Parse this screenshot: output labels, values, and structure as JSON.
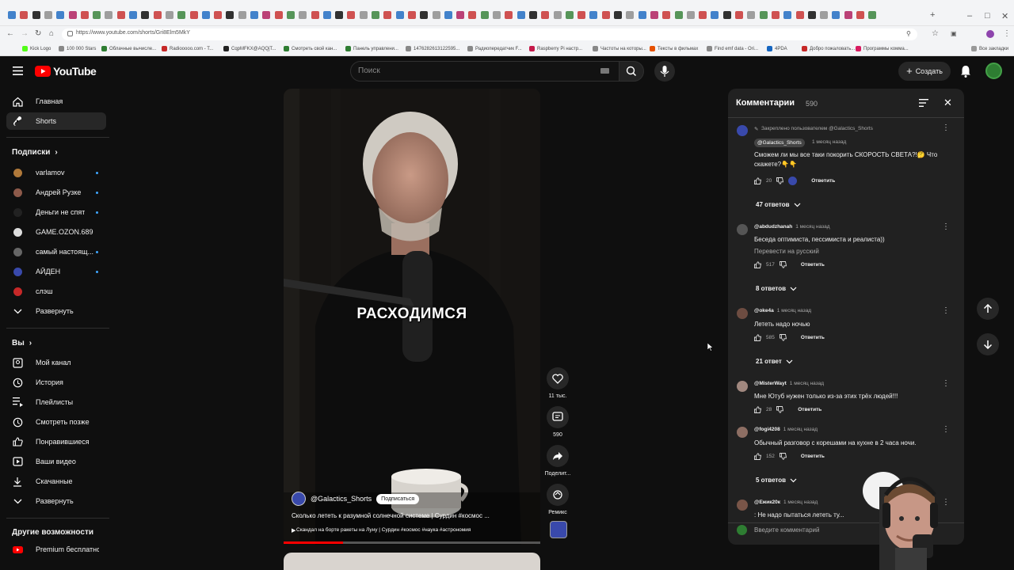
{
  "browser": {
    "url": "https://www.youtube.com/shorts/Gri8Elm5MkY",
    "bookmarks": [
      {
        "label": "Kick Logo",
        "color": "#53fc18"
      },
      {
        "label": "100 000 Stars",
        "color": "#888888"
      },
      {
        "label": "Облачные вычисле...",
        "color": "#2e7d32"
      },
      {
        "label": "Radiooooo.com - T...",
        "color": "#c62828"
      },
      {
        "label": "CqpMFKX@AQQjT...",
        "color": "#222222"
      },
      {
        "label": "Смотреть свой кан...",
        "color": "#2e7d32"
      },
      {
        "label": "Панель управлени...",
        "color": "#2e7d32"
      },
      {
        "label": "1476282613122595...",
        "color": "#888888"
      },
      {
        "label": "Радиопередатчик F...",
        "color": "#888888"
      },
      {
        "label": "Raspberry Pi настр...",
        "color": "#c51a4a"
      },
      {
        "label": "Частоты на которы...",
        "color": "#888888"
      },
      {
        "label": "Тексты в фильмах",
        "color": "#e65100"
      },
      {
        "label": "Find emf data - Ori...",
        "color": "#888888"
      },
      {
        "label": "4PDA",
        "color": "#1565c0"
      },
      {
        "label": "Добро пожаловать...",
        "color": "#c62828"
      },
      {
        "label": "Программы комма...",
        "color": "#d81b60"
      }
    ],
    "all_bookmarks_label": "Все закладки"
  },
  "header": {
    "logo": "YouTube",
    "search_placeholder": "Поиск",
    "create_label": "Создать"
  },
  "sidebar": {
    "main": [
      {
        "label": "Главная",
        "icon": "home-icon",
        "active": false
      },
      {
        "label": "Shorts",
        "icon": "shorts-icon",
        "active": true
      }
    ],
    "subscriptions_title": "Подписки",
    "subscriptions": [
      {
        "label": "varlamov",
        "color": "#b0793a",
        "dot": true
      },
      {
        "label": "Андрей Рузке",
        "color": "#8d5a4a",
        "dot": true
      },
      {
        "label": "Деньги не спят",
        "color": "#222222",
        "dot": true
      },
      {
        "label": "GAME.OZON.689",
        "color": "#dddddd",
        "dot": false
      },
      {
        "label": "самый настоящ...",
        "color": "#666666",
        "dot": true
      },
      {
        "label": "АЙДЕН",
        "color": "#3949ab",
        "dot": true
      },
      {
        "label": "слэш",
        "color": "#c62828",
        "dot": false
      }
    ],
    "expand_label": "Развернуть",
    "you_title": "Вы",
    "you_items": [
      {
        "label": "Мой канал",
        "icon": "channel-icon"
      },
      {
        "label": "История",
        "icon": "history-icon"
      },
      {
        "label": "Плейлисты",
        "icon": "playlists-icon"
      },
      {
        "label": "Смотреть позже",
        "icon": "watch-later-icon"
      },
      {
        "label": "Понравившиеся",
        "icon": "like-icon"
      },
      {
        "label": "Ваши видео",
        "icon": "your-videos-icon"
      },
      {
        "label": "Скачанные",
        "icon": "downloads-icon"
      }
    ],
    "expand_label_2": "Развернуть",
    "more_title": "Другие возможности",
    "premium_label": "Premium бесплатно"
  },
  "video": {
    "caption": "РАСХОДИМСЯ",
    "channel": "@Galactics_Shorts",
    "subscribe": "Подписаться",
    "title": "Сколько лететь к разумной солнечной системе  | Сурдин #космос ...",
    "sub_link": "Скандал на борте ракеты на Луну | Сурдин #космос #наука #астрономия",
    "progress": 0.23
  },
  "actions": {
    "likes": "11 тыс.",
    "comments": "590",
    "share": "Поделит...",
    "remix": "Ремикс"
  },
  "comments": {
    "title": "Комментарии",
    "count": "590",
    "pinned_label": "Закреплено пользователем @Galactics_Shorts",
    "input_placeholder": "Введите комментарий",
    "reply_label": "Ответить",
    "items": [
      {
        "author": "@Galactics_Shorts",
        "time": "1 месяц назад",
        "text": "Сможем ли мы все таки покорить СКОРОСТЬ СВЕТА?!🤔 Что скажете?👇👇",
        "likes": "20",
        "replies": "47 ответов",
        "avatar": "#3949ab"
      },
      {
        "author": "@abdudzhanah",
        "time": "1 месяц назад",
        "text": "Беседа оптимиста, пессимиста и реалиста))",
        "translate": "Перевести на русский",
        "likes": "517",
        "replies": "8 ответов",
        "avatar": "#555555"
      },
      {
        "author": "@oke4a",
        "time": "1 месяц назад",
        "text": "Лететь надо ночью",
        "likes": "585",
        "replies": "21 ответ",
        "avatar": "#6d4c41"
      },
      {
        "author": "@MisterWayt",
        "time": "1 месяц назад",
        "text": "Мне Ютуб нужен только из-за этих трёх людей!!!",
        "likes": "28",
        "replies": "",
        "avatar": "#a1887f"
      },
      {
        "author": "@fogi4208",
        "time": "1 месяц назад",
        "text": "Обычный разговор с корешами на кухне в 2 часа ночи.",
        "likes": "152",
        "replies": "5 ответов",
        "avatar": "#8d6e63"
      },
      {
        "author": "@Ежик20к",
        "time": "1 месяц назад",
        "text": ": Не надо пытаться лететь ту...",
        "likes": "",
        "replies": "",
        "avatar": "#795548"
      }
    ]
  },
  "colors": {
    "background": "#0f0f0f",
    "panel": "#212121",
    "accent_red": "#ff0000",
    "link_blue": "#3ea6ff"
  }
}
